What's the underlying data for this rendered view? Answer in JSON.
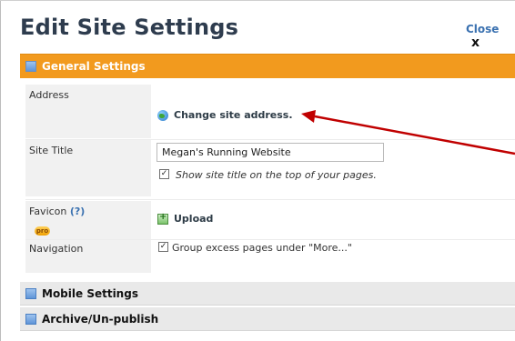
{
  "dialog": {
    "title": "Edit Site Settings",
    "close_label": "Close",
    "close_x": "x"
  },
  "sections": {
    "general": "General Settings",
    "mobile": "Mobile Settings",
    "archive": "Archive/Un-publish"
  },
  "rows": {
    "address": {
      "label": "Address",
      "action": "Change site address."
    },
    "site_title": {
      "label": "Site Title",
      "value": "Megan's Running Website",
      "checkbox_label": "Show site title on the top of your pages."
    },
    "favicon": {
      "label": "Favicon",
      "help": "(?)",
      "badge": "pro",
      "action": "Upload"
    },
    "navigation": {
      "label": "Navigation",
      "checkbox_label": "Group excess pages under \"More...\""
    }
  },
  "checkbox_checked_glyph": "✓",
  "colors": {
    "general_header": "#f29a1e",
    "section_header": "#e9e9e9",
    "annotation_arrow": "#c00000",
    "link": "#3a71b0",
    "title": "#2e3c4e"
  }
}
